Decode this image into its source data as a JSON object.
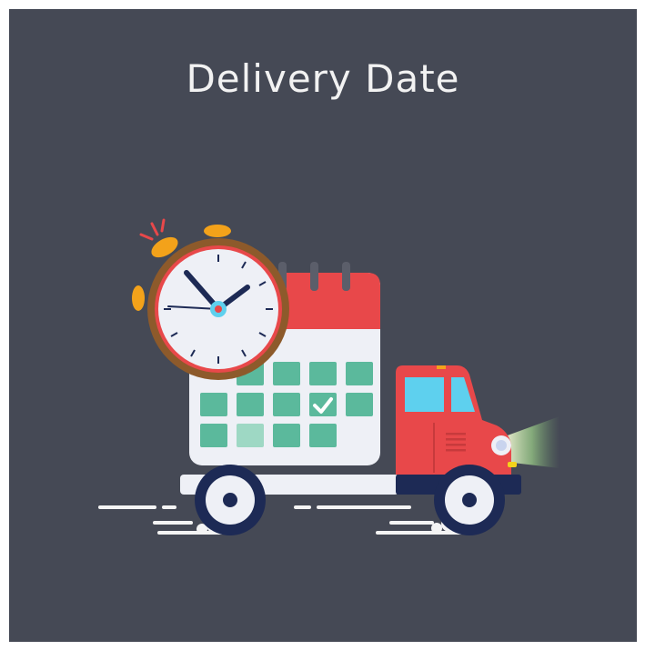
{
  "title": "Delivery Date",
  "colors": {
    "background": "#454955",
    "title_text": "#f2f2f2",
    "truck_red": "#e8484a",
    "truck_navy": "#1d2a55",
    "calendar_grid": "#5bb99c",
    "clock_rim": "#8d5a2b",
    "alarm_bells": "#f3a21a"
  },
  "illustration": {
    "icon": "delivery-truck-with-calendar-and-alarm-clock-icon"
  }
}
